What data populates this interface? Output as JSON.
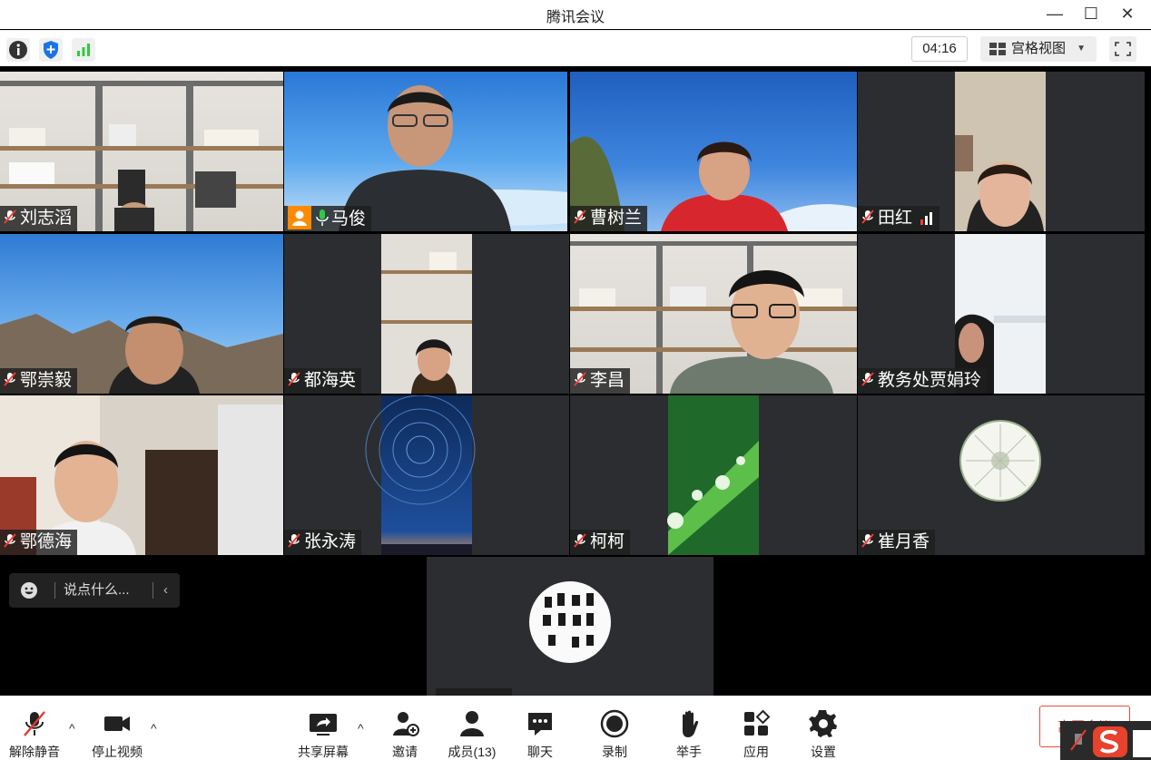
{
  "window": {
    "title": "腾讯会议",
    "minimize": "—",
    "maximize": "☐",
    "close": "✕"
  },
  "infobar": {
    "timer": "04:16",
    "view_mode": "宫格视图",
    "caret": "▼"
  },
  "participants": [
    {
      "name": "刘志滔"
    },
    {
      "name": "马俊"
    },
    {
      "name": "曹树兰"
    },
    {
      "name": "田红"
    },
    {
      "name": "鄂崇毅"
    },
    {
      "name": "都海英"
    },
    {
      "name": "李昌"
    },
    {
      "name": "教务处贾娟玲"
    },
    {
      "name": "鄂德海"
    },
    {
      "name": "张永涛"
    },
    {
      "name": "柯柯"
    },
    {
      "name": "崔月香"
    }
  ],
  "chat": {
    "placeholder": "说点什么...",
    "collapse": "‹"
  },
  "toolbar": {
    "unmute": "解除静音",
    "stop_video": "停止视频",
    "share_screen": "共享屏幕",
    "invite": "邀请",
    "members": "成员(13)",
    "chat": "聊天",
    "record": "录制",
    "raise_hand": "举手",
    "apps": "应用",
    "settings": "设置",
    "caret": "^",
    "leave": "离开会议"
  },
  "colors": {
    "accent": "#0a6cff",
    "host_badge": "#ff8a00",
    "signal": "#2ecc40",
    "leave": "#e74c3c"
  }
}
